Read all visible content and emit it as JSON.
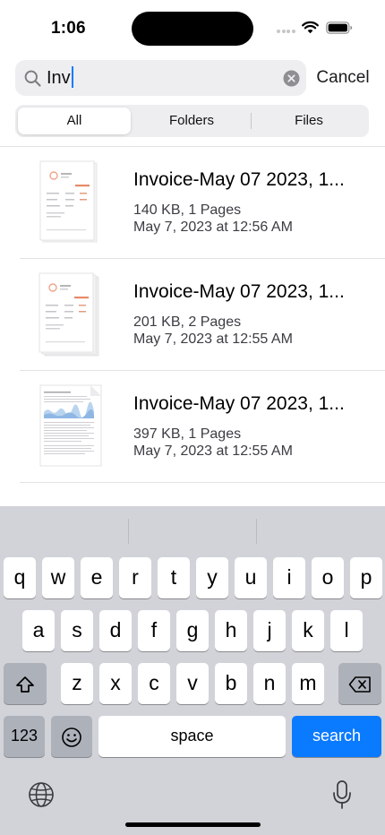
{
  "status_bar": {
    "time": "1:06",
    "wifi_icon": "wifi-icon",
    "battery_icon": "battery-icon"
  },
  "search": {
    "query": "Inv",
    "cancel_label": "Cancel",
    "search_icon": "search-icon",
    "clear_icon": "clear-icon",
    "caret_color": "#0a7aff"
  },
  "segments": {
    "all": "All",
    "folders": "Folders",
    "files": "Files",
    "selected": "All"
  },
  "files": [
    {
      "title": "Invoice-May 07 2023, 1...",
      "size_pages": "140 KB, 1 Pages",
      "date": "May 7, 2023 at 12:56 AM",
      "thumbnail": "invoice-document-thumbnail"
    },
    {
      "title": "Invoice-May 07 2023, 1...",
      "size_pages": "201 KB, 2 Pages",
      "date": "May 7, 2023 at 12:55 AM",
      "thumbnail": "invoice-document-thumbnail"
    },
    {
      "title": "Invoice-May 07 2023, 1...",
      "size_pages": "397 KB, 1 Pages",
      "date": "May 7, 2023 at 12:55 AM",
      "thumbnail": "report-document-thumbnail"
    }
  ],
  "keyboard": {
    "row1": [
      "q",
      "w",
      "e",
      "r",
      "t",
      "y",
      "u",
      "i",
      "o",
      "p"
    ],
    "row2": [
      "a",
      "s",
      "d",
      "f",
      "g",
      "h",
      "j",
      "k",
      "l"
    ],
    "row3": [
      "z",
      "x",
      "c",
      "v",
      "b",
      "n",
      "m"
    ],
    "numbers_key": "123",
    "space_key": "space",
    "search_key": "search",
    "shift_icon": "shift-icon",
    "delete_icon": "delete-icon",
    "emoji_icon": "emoji-icon",
    "globe_icon": "globe-icon",
    "mic_icon": "microphone-icon",
    "accent_color": "#0a7aff"
  }
}
